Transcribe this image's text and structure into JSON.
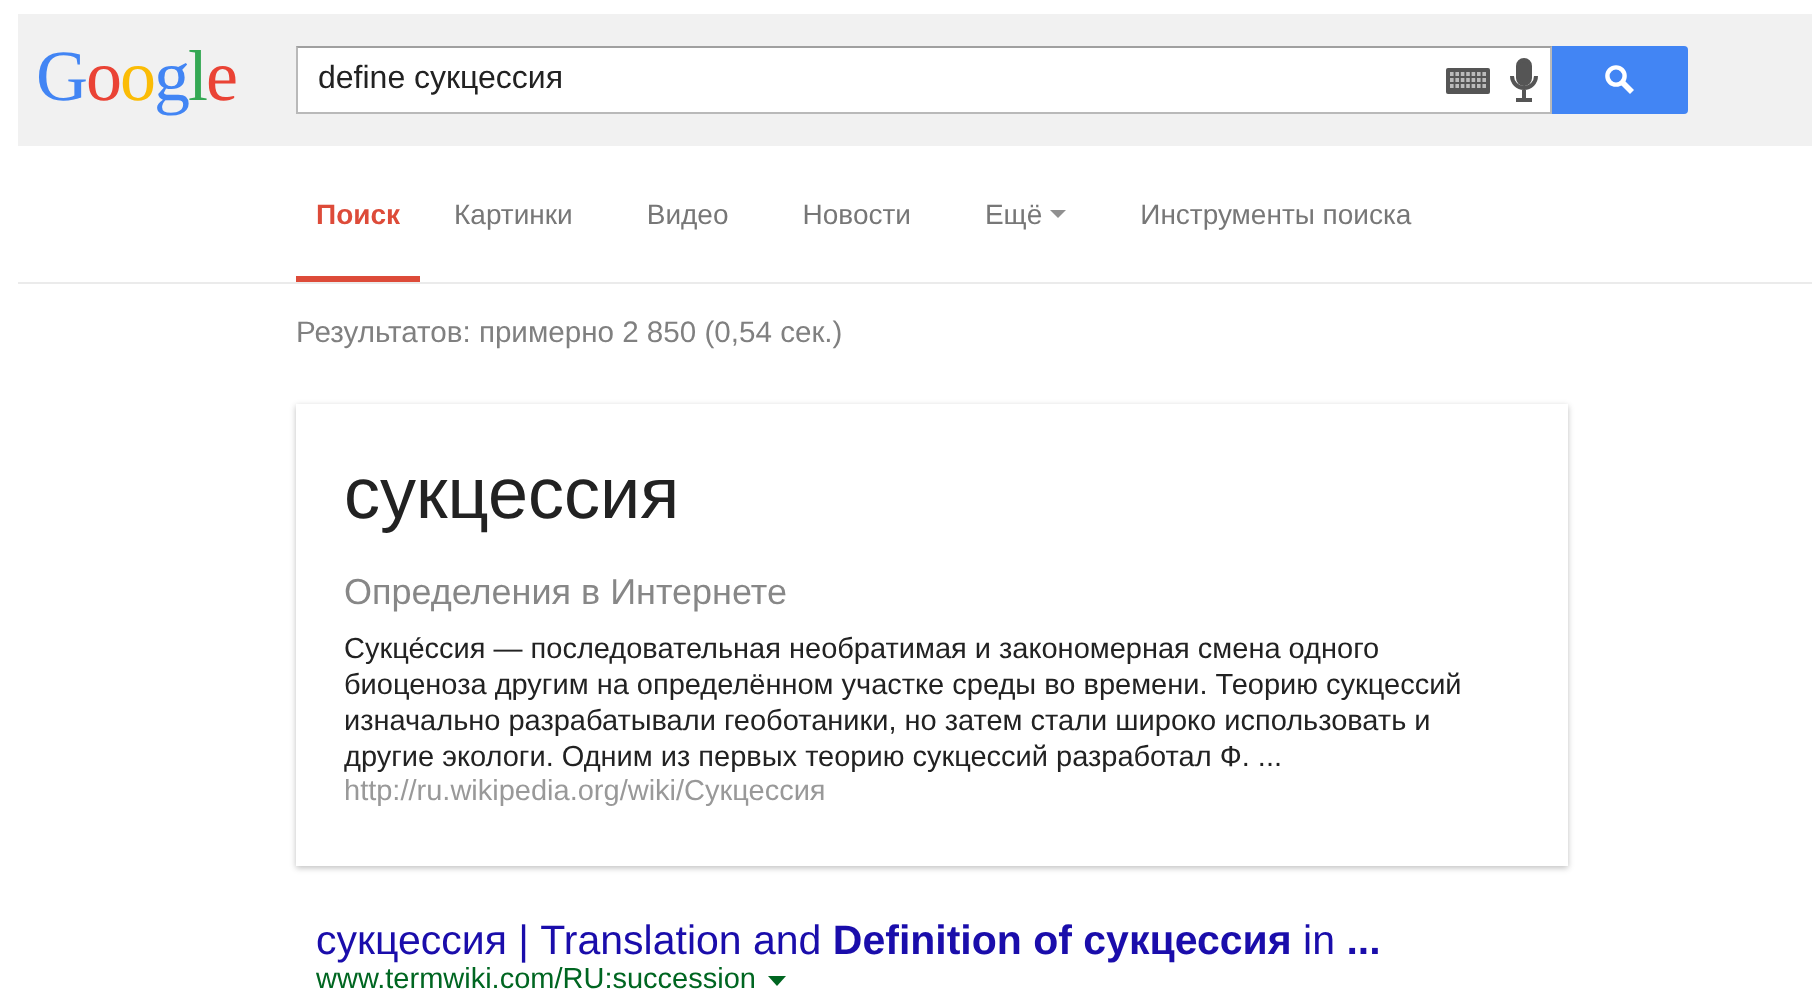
{
  "header": {
    "logo": "Google",
    "search": {
      "value": "define сукцессия"
    }
  },
  "tabs": [
    {
      "label": "Поиск",
      "selected": true,
      "dropdown": false
    },
    {
      "label": "Картинки",
      "selected": false,
      "dropdown": false
    },
    {
      "label": "Видео",
      "selected": false,
      "dropdown": false
    },
    {
      "label": "Новости",
      "selected": false,
      "dropdown": false
    },
    {
      "label": "Ещё",
      "selected": false,
      "dropdown": true
    },
    {
      "label": "Инструменты поиска",
      "selected": false,
      "dropdown": false
    }
  ],
  "result_stats": "Результатов: примерно 2 850 (0,54 сек.)",
  "definition_card": {
    "term": "сукцессия",
    "source_heading": "Определения в Интернете",
    "snippet": "Сукце́ссия — последовательная необратимая и закономерная смена одного биоценоза другим на определённом участке среды во времени. Теорию сукцессий изначально разрабатывали геоботаники, но затем стали широко использовать и другие экологи. Одним из первых теорию сукцессий разработал Ф. ...",
    "url": "http://ru.wikipedia.org/wiki/Сукцессия"
  },
  "results": [
    {
      "title": "сукцессия | Translation and **Definition of сукцессия** in **...**",
      "url": "www.termwiki.com/RU:succession"
    }
  ]
}
